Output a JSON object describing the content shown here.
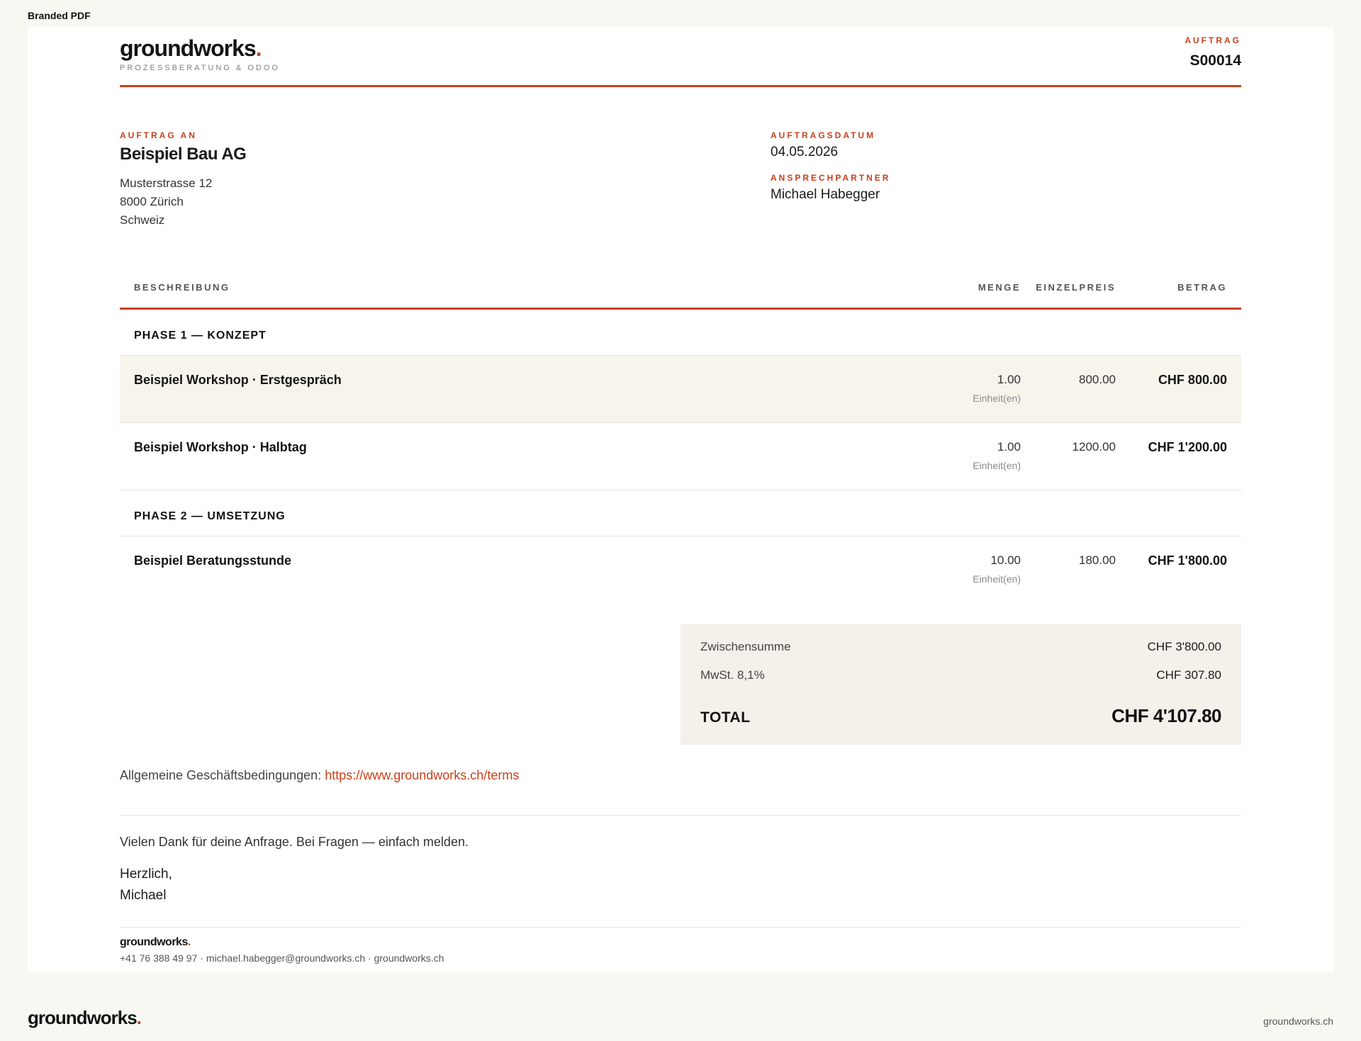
{
  "page": {
    "label": "Branded PDF"
  },
  "header": {
    "brand_name": "groundworks",
    "brand_dot": ".",
    "tagline": "PROZESSBERATUNG & ODOO",
    "order_label": "AUFTRAG",
    "order_number": "S00014"
  },
  "recipient": {
    "label": "AUFTRAG AN",
    "company": "Beispiel Bau AG",
    "street": "Musterstrasse 12",
    "city": "8000 Zürich",
    "country": "Schweiz"
  },
  "meta": {
    "date_label": "AUFTRAGSDATUM",
    "date_value": "04.05.2026",
    "contact_label": "ANSPRECHPARTNER",
    "contact_value": "Michael Habegger"
  },
  "table": {
    "headers": {
      "description": "BESCHREIBUNG",
      "quantity": "MENGE",
      "unit_price": "EINZELPREIS",
      "amount": "BETRAG"
    },
    "sections": [
      {
        "title": "PHASE 1 — KONZEPT",
        "lines": [
          {
            "description": "Beispiel Workshop · Erstgespräch",
            "qty": "1.00",
            "unit": "Einheit(en)",
            "price": "800.00",
            "amount": "CHF 800.00"
          },
          {
            "description": "Beispiel Workshop · Halbtag",
            "qty": "1.00",
            "unit": "Einheit(en)",
            "price": "1200.00",
            "amount": "CHF 1'200.00"
          }
        ]
      },
      {
        "title": "PHASE 2 — UMSETZUNG",
        "lines": [
          {
            "description": "Beispiel Beratungsstunde",
            "qty": "10.00",
            "unit": "Einheit(en)",
            "price": "180.00",
            "amount": "CHF 1'800.00"
          }
        ]
      }
    ]
  },
  "totals": {
    "subtotal_label": "Zwischensumme",
    "subtotal_value": "CHF 3'800.00",
    "tax_label": "MwSt. 8,1%",
    "tax_value": "CHF 307.80",
    "total_label": "TOTAL",
    "total_value": "CHF 4'107.80"
  },
  "terms": {
    "label": "Allgemeine Geschäftsbedingungen:",
    "link": "https://www.groundworks.ch/terms"
  },
  "closing": {
    "thanks": "Vielen Dank für deine Anfrage. Bei Fragen — einfach melden.",
    "greeting": "Herzlich,",
    "name": "Michael"
  },
  "footer": {
    "brand_name": "groundworks",
    "brand_dot": ".",
    "contact": "+41 76 388 49 97 · michael.habegger@groundworks.ch · groundworks.ch"
  },
  "page_footer": {
    "brand_name": "groundworks",
    "brand_dot": ".",
    "url": "groundworks.ch"
  },
  "colors": {
    "accent": "#c8401a",
    "background": "#f8f8f3",
    "totals_bg": "#f4f0ea",
    "highlight_row": "#f7f4ec"
  }
}
